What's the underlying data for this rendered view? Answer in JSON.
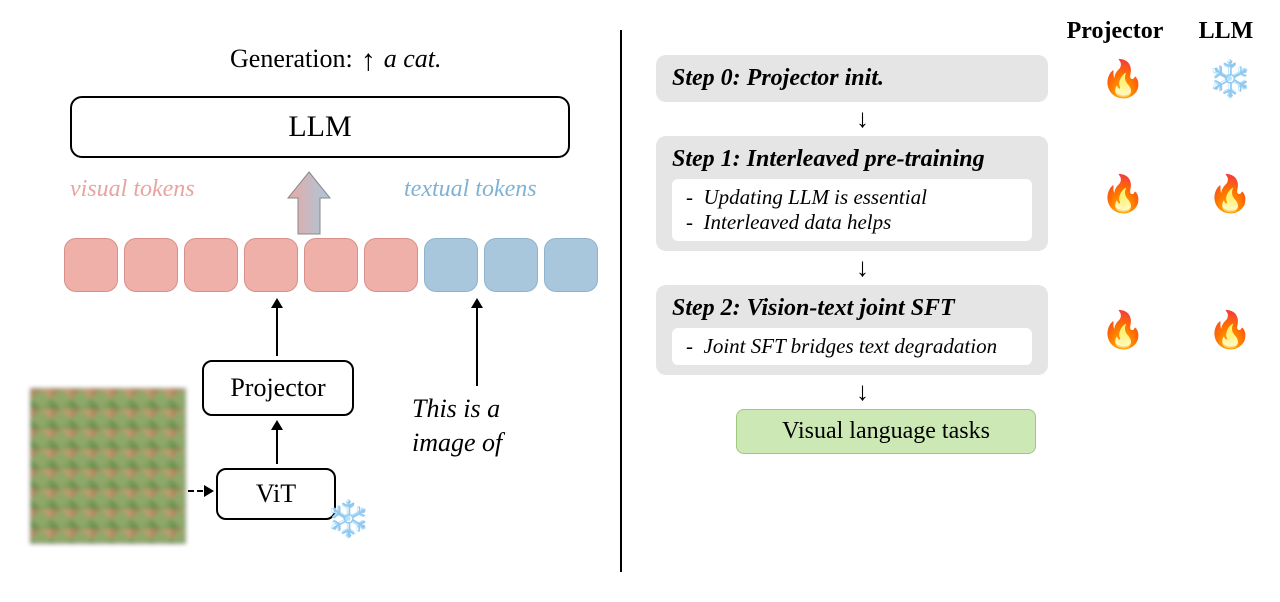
{
  "left": {
    "generation_label": "Generation:",
    "generation_output": "a cat.",
    "llm_label": "LLM",
    "visual_tokens_label": "visual tokens",
    "textual_tokens_label": "textual tokens",
    "projector_label": "Projector",
    "vit_label": "ViT",
    "caption_line1": "This is a",
    "caption_line2": "image of",
    "vit_frozen_icon": "snowflake-icon",
    "input_image_alt": "pixelated cat photo"
  },
  "right": {
    "header_projector": "Projector",
    "header_llm": "LLM",
    "steps": [
      {
        "title": "Step 0: Projector init.",
        "bullets": [],
        "projector_state": "fire",
        "llm_state": "snowflake"
      },
      {
        "title": "Step 1: Interleaved pre-training",
        "bullets": [
          "Updating LLM is essential",
          "Interleaved data helps"
        ],
        "projector_state": "fire",
        "llm_state": "fire"
      },
      {
        "title": "Step 2: Vision-text joint SFT",
        "bullets": [
          "Joint SFT bridges text degradation"
        ],
        "projector_state": "fire",
        "llm_state": "fire"
      }
    ],
    "final_label": "Visual language tasks"
  },
  "icons": {
    "fire": "🔥",
    "snowflake": "❄️"
  }
}
